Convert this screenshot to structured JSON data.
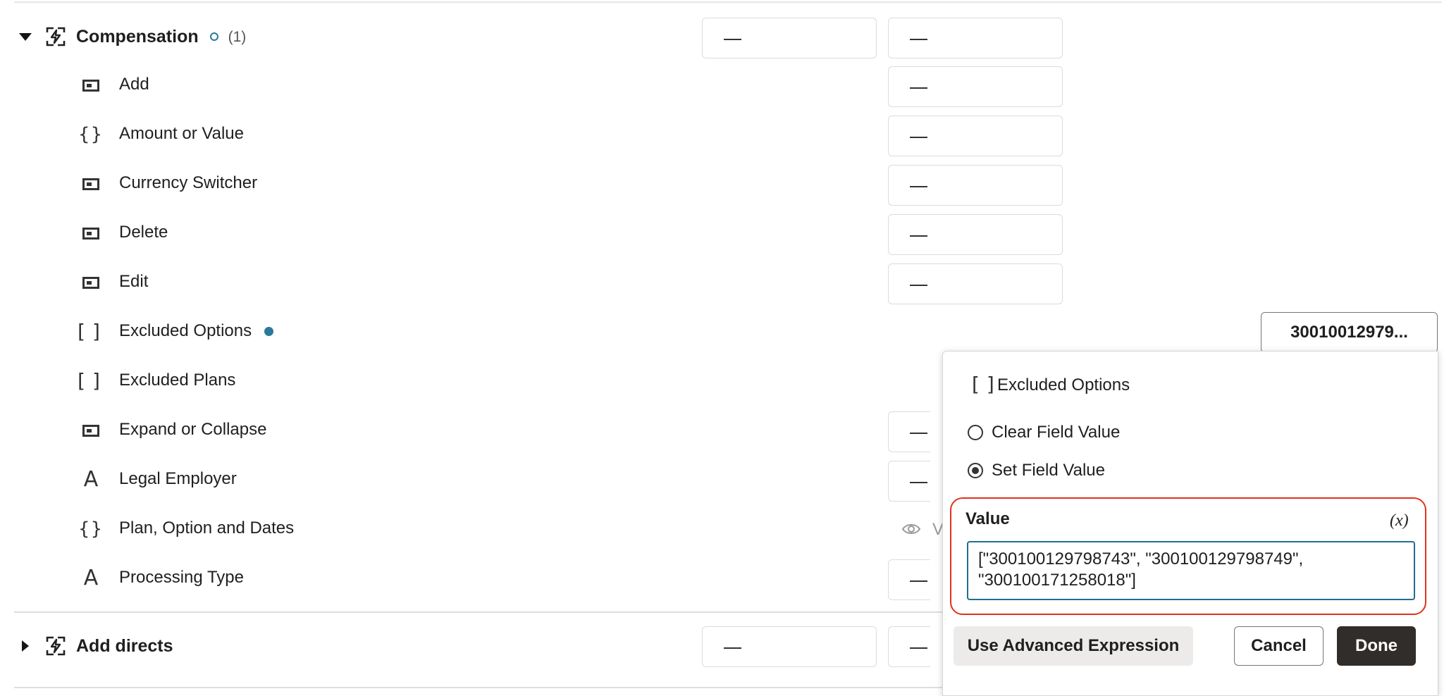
{
  "groups": [
    {
      "label": "Compensation",
      "count": "(1)"
    },
    {
      "label": "Add directs"
    }
  ],
  "fields": [
    {
      "label": "Add",
      "icon": "action-icon"
    },
    {
      "label": "Amount or Value",
      "icon": "object-icon"
    },
    {
      "label": "Currency Switcher",
      "icon": "action-icon"
    },
    {
      "label": "Delete",
      "icon": "action-icon"
    },
    {
      "label": "Edit",
      "icon": "action-icon"
    },
    {
      "label": "Excluded Options",
      "icon": "array-icon"
    },
    {
      "label": "Excluded Plans",
      "icon": "array-icon"
    },
    {
      "label": "Expand or Collapse",
      "icon": "action-icon"
    },
    {
      "label": "Legal Employer",
      "icon": "text-icon"
    },
    {
      "label": "Plan, Option and Dates",
      "icon": "object-icon"
    },
    {
      "label": "Processing Type",
      "icon": "text-icon"
    }
  ],
  "dash": "—",
  "excluded_options_value": "30010012979...",
  "view_label": "V",
  "popup": {
    "title": "Excluded Options",
    "clear_label": "Clear Field Value",
    "set_label": "Set Field Value",
    "selected": "set",
    "value_label": "Value",
    "expr_toggle": "(x)",
    "value_text": "[\"300100129798743\", \"300100129798749\",\n\"300100171258018\"]",
    "advanced_label": "Use Advanced Expression",
    "cancel_label": "Cancel",
    "done_label": "Done"
  },
  "colors": {
    "accent": "#2a7a9b",
    "highlight": "#e0321c",
    "primary_button": "#312d2a"
  }
}
